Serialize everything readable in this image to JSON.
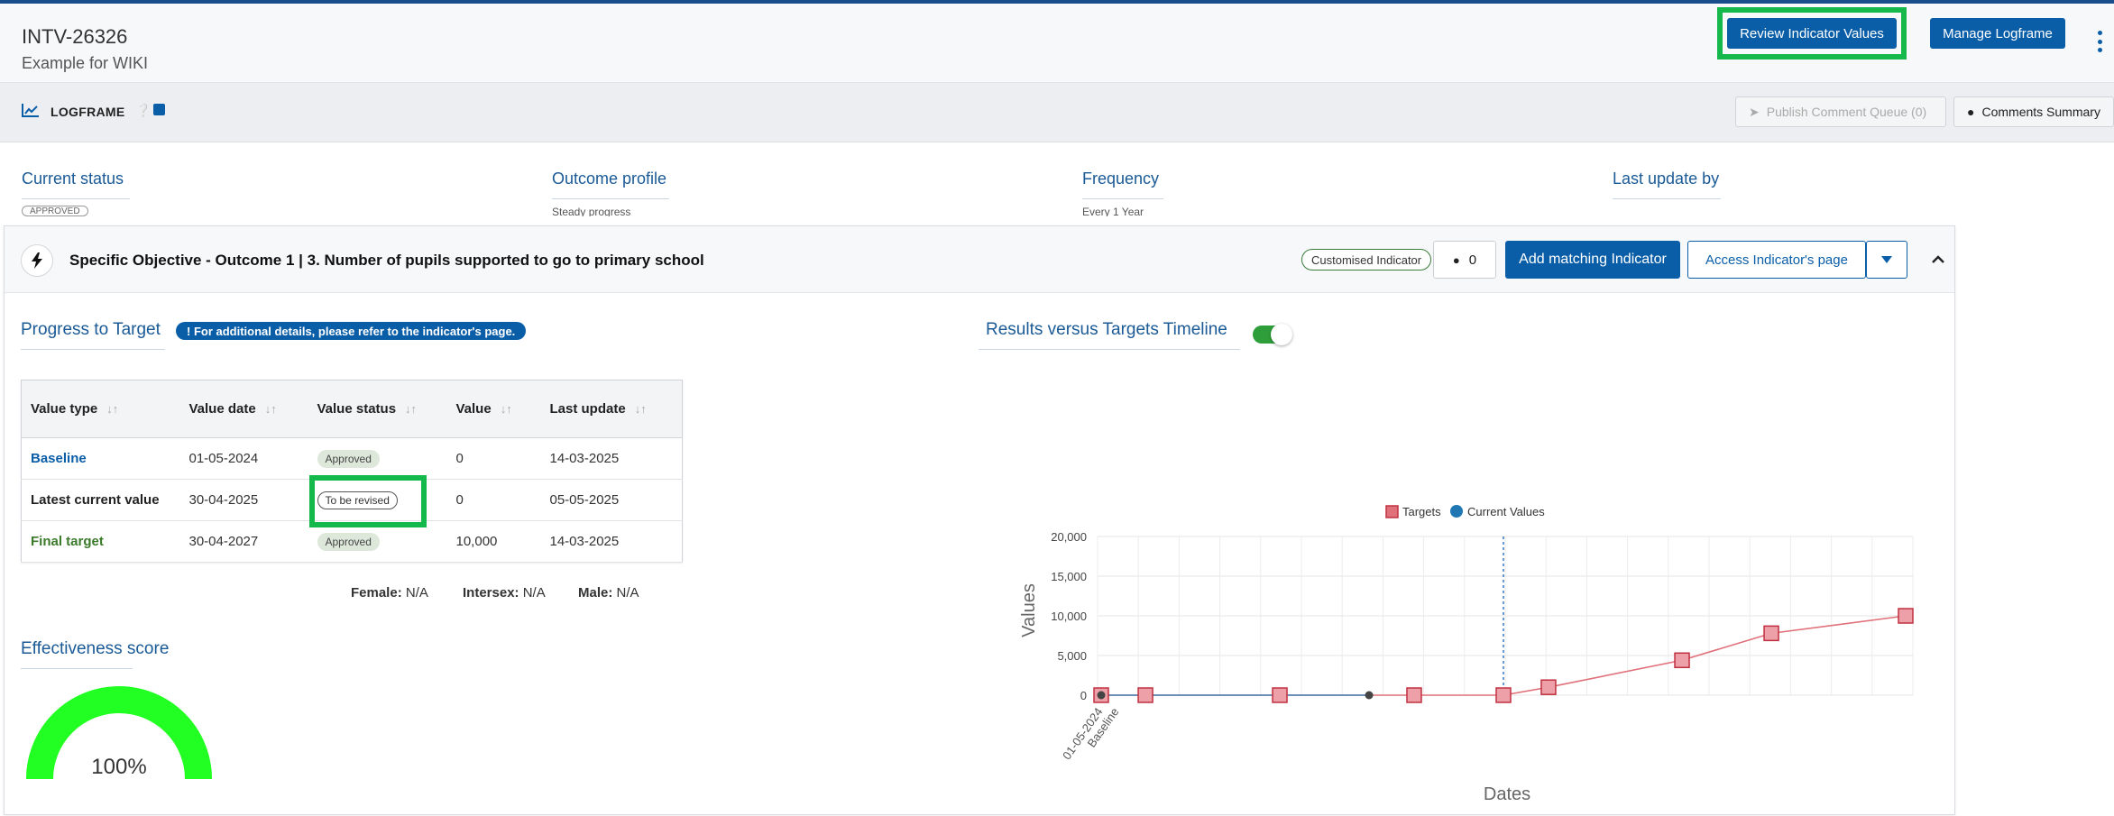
{
  "header": {
    "id": "INTV-26326",
    "subtitle": "Example for WIKI",
    "review_button": "Review Indicator Values",
    "manage_button": "Manage Logframe"
  },
  "logframe_bar": {
    "title": "LOGFRAME",
    "publish_button": "Publish Comment Queue (0)",
    "comments_button": "Comments Summary"
  },
  "status_row": {
    "current_status_label": "Current status",
    "current_status_value": "APPROVED",
    "outcome_profile_label": "Outcome profile",
    "outcome_profile_value": "Steady progress",
    "frequency_label": "Frequency",
    "frequency_value": "Every 1 Year",
    "last_update_by_label": "Last update by"
  },
  "objective": {
    "title": "Specific Objective - Outcome 1 | 3. Number of pupils supported to go to primary school",
    "custom_tag": "Customised Indicator",
    "comment_count": "0",
    "add_matching_button": "Add matching Indicator",
    "access_page_button": "Access Indicator's page"
  },
  "progress": {
    "title": "Progress to Target",
    "info": "! For additional details, please refer to the indicator's page.",
    "columns": [
      "Value type",
      "Value date",
      "Value status",
      "Value",
      "Last update"
    ],
    "rows": [
      {
        "type": "Baseline",
        "date": "01-05-2024",
        "status": "Approved",
        "value": "0",
        "updated": "14-03-2025"
      },
      {
        "type": "Latest current value",
        "date": "30-04-2025",
        "status": "To be revised",
        "value": "0",
        "updated": "05-05-2025"
      },
      {
        "type": "Final target",
        "date": "30-04-2027",
        "status": "Approved",
        "value": "10,000",
        "updated": "14-03-2025"
      }
    ],
    "female_label": "Female:",
    "female_value": "N/A",
    "intersex_label": "Intersex:",
    "intersex_value": "N/A",
    "male_label": "Male:",
    "male_value": "N/A"
  },
  "effectiveness": {
    "title": "Effectiveness score",
    "value": "100%",
    "fraction": 1.0,
    "color": "#22ff22"
  },
  "timeline": {
    "title": "Results versus Targets Timeline",
    "toggle_on": true
  },
  "chart_data": {
    "type": "line",
    "title": "",
    "xlabel": "Dates",
    "ylabel": "Values",
    "ylim": [
      0,
      20000
    ],
    "yticks": [
      "0",
      "5,000",
      "10,000",
      "15,000",
      "20,000"
    ],
    "x_tick_label_date": "01-05-2024",
    "x_tick_label_name": "Baseline",
    "legend": [
      "Targets",
      "Current Values"
    ],
    "legend_position": "top",
    "grid": true,
    "series": [
      {
        "name": "Targets",
        "color": "#e0707a",
        "points": [
          [
            0,
            0
          ],
          [
            0.055,
            0
          ],
          [
            0.222,
            0
          ],
          [
            0.389,
            0
          ],
          [
            0.5,
            0
          ],
          [
            0.556,
            1000
          ],
          [
            0.722,
            4400
          ],
          [
            0.833,
            7800
          ],
          [
            1.0,
            10000
          ]
        ]
      },
      {
        "name": "Current Values",
        "color": "#1f77b4",
        "points": [
          [
            0,
            0
          ],
          [
            0.333,
            0
          ]
        ]
      }
    ],
    "current_date_marker": 0.5
  }
}
